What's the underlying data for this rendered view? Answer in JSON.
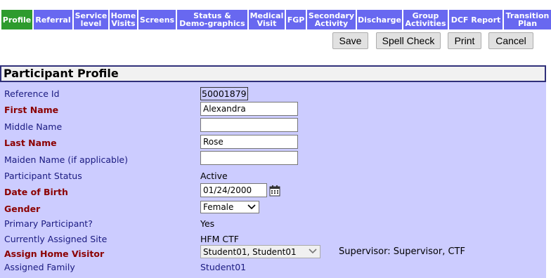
{
  "tabs": [
    {
      "label": "Profile",
      "active": true
    },
    {
      "label": "Referral"
    },
    {
      "label": "Service\nlevel"
    },
    {
      "label": "Home\nVisits"
    },
    {
      "label": "Screens"
    },
    {
      "label": "Status &\nDemo-graphics"
    },
    {
      "label": "Medical\nVisit"
    },
    {
      "label": "FGP"
    },
    {
      "label": "Secondary\nActivity"
    },
    {
      "label": "Discharge"
    },
    {
      "label": "Group\nActivities"
    },
    {
      "label": "DCF Report"
    },
    {
      "label": "Transition\nPlan"
    }
  ],
  "toolbar": {
    "save": "Save",
    "spell_check": "Spell Check",
    "print": "Print",
    "cancel": "Cancel"
  },
  "panel_title": "Participant Profile",
  "fields": {
    "reference_id": {
      "label": "Reference Id",
      "value": "50001879"
    },
    "first_name": {
      "label": "First Name",
      "value": "Alexandra"
    },
    "middle_name": {
      "label": "Middle Name",
      "value": ""
    },
    "last_name": {
      "label": "Last Name",
      "value": "Rose"
    },
    "maiden_name": {
      "label": "Maiden Name (if applicable)",
      "value": ""
    },
    "participant_status": {
      "label": "Participant Status",
      "value": "Active"
    },
    "date_of_birth": {
      "label": "Date of Birth",
      "value": "01/24/2000"
    },
    "gender": {
      "label": "Gender",
      "value": "Female"
    },
    "primary_participant": {
      "label": "Primary Participant?",
      "value": "Yes"
    },
    "assigned_site": {
      "label": "Currently Assigned Site",
      "value": "HFM CTF"
    },
    "home_visitor": {
      "label": "Assign Home Visitor",
      "value": "Student01, Student01"
    },
    "supervisor": "Supervisor: Supervisor, CTF",
    "assigned_family": {
      "label": "Assigned Family",
      "value": "Student01"
    }
  },
  "icons": {
    "calendar": "calendar-icon",
    "dropdown": "chevron-down-icon"
  },
  "colors": {
    "tab": "#6868f0",
    "tab_active": "#2e9b2e",
    "panel_bg": "#ccccff",
    "label": "#1a1a80",
    "required_label": "#8b0000"
  }
}
